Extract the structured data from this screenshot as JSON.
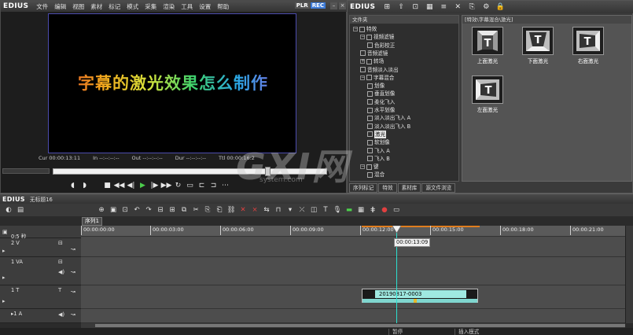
{
  "app": {
    "logo": "EDIUS",
    "menu": [
      "文件",
      "编辑",
      "视图",
      "素材",
      "标记",
      "模式",
      "采集",
      "渲染",
      "工具",
      "设置",
      "帮助"
    ],
    "plr": "PLR",
    "rec": "REC"
  },
  "monitor": {
    "caption": "字幕的激光效果怎么制作",
    "cur_label": "Cur",
    "cur_value": "00:00:13:11",
    "in_label": "In",
    "in_value": "--:--:--:--",
    "out_label": "Out",
    "out_value": "--:--:--:--",
    "dur_label": "Dur",
    "dur_value": "--:--:--:--",
    "ttl_label": "Ttl",
    "ttl_value": "00:00:16:2"
  },
  "effects": {
    "tree_header": "文件夹",
    "thumb_header": "[特效\\字幕混合\\激光]",
    "tree": [
      {
        "label": "特效",
        "indent": 0,
        "expand": "−",
        "selected": false
      },
      {
        "label": "视频滤镜",
        "indent": 1,
        "expand": "−",
        "selected": false
      },
      {
        "label": "色彩校正",
        "indent": 2,
        "expand": "",
        "selected": false
      },
      {
        "label": "音频滤镜",
        "indent": 1,
        "expand": "",
        "selected": false
      },
      {
        "label": "转场",
        "indent": 1,
        "expand": "+",
        "selected": false
      },
      {
        "label": "音频淡入淡出",
        "indent": 1,
        "expand": "",
        "selected": false
      },
      {
        "label": "字幕混合",
        "indent": 1,
        "expand": "−",
        "selected": false
      },
      {
        "label": "划像",
        "indent": 2,
        "expand": "",
        "selected": false
      },
      {
        "label": "垂直划像",
        "indent": 2,
        "expand": "",
        "selected": false
      },
      {
        "label": "柔化飞入",
        "indent": 2,
        "expand": "",
        "selected": false
      },
      {
        "label": "水平划像",
        "indent": 2,
        "expand": "",
        "selected": false
      },
      {
        "label": "淡入淡出飞入 A",
        "indent": 2,
        "expand": "",
        "selected": false
      },
      {
        "label": "淡入淡出飞入 B",
        "indent": 2,
        "expand": "",
        "selected": false
      },
      {
        "label": "激光",
        "indent": 2,
        "expand": "",
        "selected": true
      },
      {
        "label": "软划像",
        "indent": 2,
        "expand": "",
        "selected": false
      },
      {
        "label": "飞入 A",
        "indent": 2,
        "expand": "",
        "selected": false
      },
      {
        "label": "飞入 B",
        "indent": 2,
        "expand": "",
        "selected": false
      },
      {
        "label": "键",
        "indent": 1,
        "expand": "−",
        "selected": false
      },
      {
        "label": "混合",
        "indent": 2,
        "expand": "",
        "selected": false
      }
    ],
    "thumbs": [
      {
        "label": "上面激光"
      },
      {
        "label": "下面激光"
      },
      {
        "label": "右面激光"
      },
      {
        "label": "左面激光"
      }
    ],
    "tabs": [
      "序列标记",
      "特效",
      "素材库",
      "源文件浏览"
    ]
  },
  "watermark": {
    "main": "GXI网",
    "sub": "system.com"
  },
  "timeline": {
    "logo": "EDIUS",
    "project_name": "无标题16",
    "sequence_tab": "序列1",
    "scale": "0:5 秒",
    "ruler": [
      "00:00:00:00",
      "00:00:03:00",
      "00:00:06:00",
      "00:00:09:00",
      "00:00:12:00",
      "00:00:15:00",
      "00:00:18:00",
      "00:00:21:00"
    ],
    "playhead_tc": "00:00:13:09",
    "tracks": [
      {
        "name": "2 V"
      },
      {
        "name": "1 VA"
      },
      {
        "name": "1 T"
      },
      {
        "name": "▸1 A"
      }
    ],
    "clip_label": "20190817-0003"
  },
  "status": {
    "left": "暂停",
    "right": "插入模式"
  }
}
